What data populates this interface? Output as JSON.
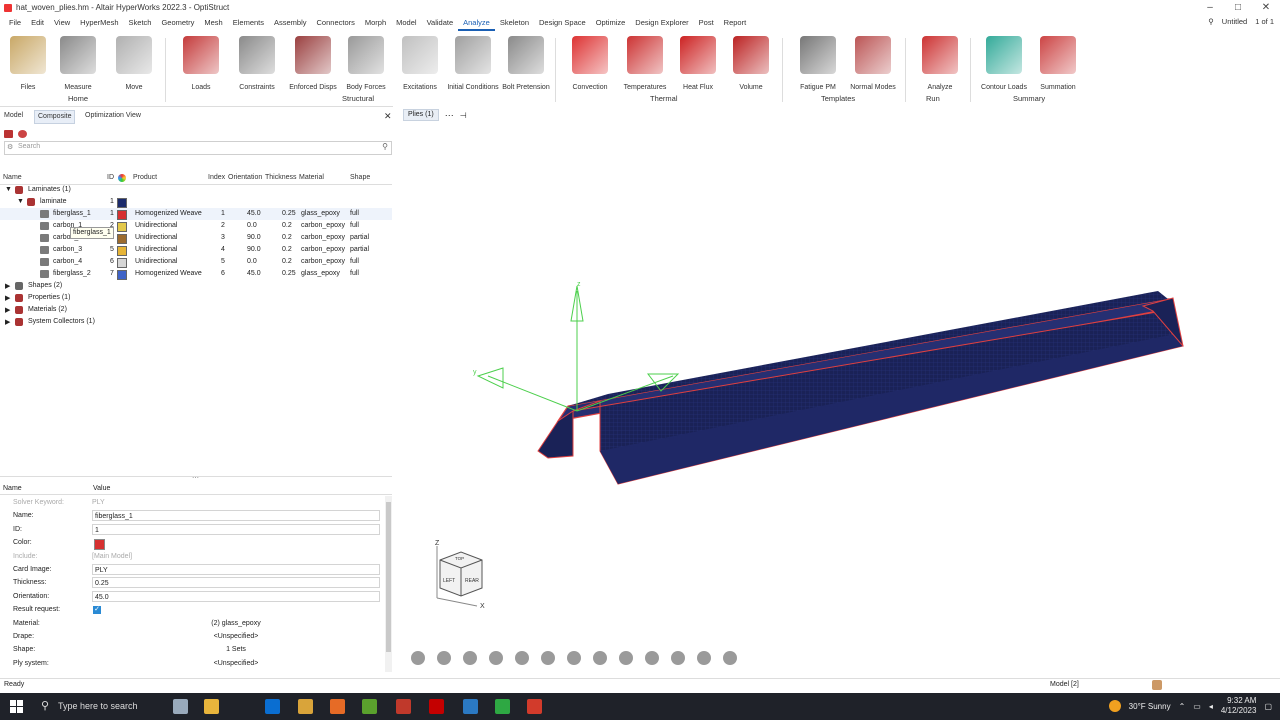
{
  "window": {
    "title": "hat_woven_plies.hm - Altair HyperWorks 2022.3 - OptiStruct",
    "controls": [
      "–",
      "□",
      "✕"
    ]
  },
  "menu": {
    "items": [
      "File",
      "Edit",
      "View",
      "HyperMesh",
      "Sketch",
      "Geometry",
      "Mesh",
      "Elements",
      "Assembly",
      "Connectors",
      "Morph",
      "Model",
      "Validate",
      "Analyze",
      "Skeleton",
      "Design Space",
      "Optimize",
      "Design Explorer",
      "Post",
      "Report"
    ],
    "active": "Analyze",
    "model_name": "Untitled",
    "page": "1 of 1"
  },
  "ribbon": {
    "tools": [
      {
        "label": "Files",
        "icon": "folder-icon",
        "color": "#c9a867"
      },
      {
        "label": "Measure",
        "icon": "measure-icon",
        "color": "#8a8a8a"
      },
      {
        "label": "Move",
        "icon": "move-icon",
        "color": "#b0b0b0"
      },
      {
        "label": "Loads",
        "icon": "loads-icon",
        "color": "#c43b3b"
      },
      {
        "label": "Constraints",
        "icon": "constraints-icon",
        "color": "#8a8a8a"
      },
      {
        "label": "Enforced Disps",
        "icon": "enforced-disps-icon",
        "color": "#9a4040"
      },
      {
        "label": "Body Forces",
        "icon": "body-forces-icon",
        "color": "#999"
      },
      {
        "label": "Excitations",
        "icon": "excitations-icon",
        "color": "#c0c0c0"
      },
      {
        "label": "Initial Conditions",
        "icon": "initial-conditions-icon",
        "color": "#a0a0a0"
      },
      {
        "label": "Bolt Pretension",
        "icon": "bolt-icon",
        "color": "#8a8a8a"
      },
      {
        "label": "Convection",
        "icon": "convection-icon",
        "color": "#d33"
      },
      {
        "label": "Temperatures",
        "icon": "temperatures-icon",
        "color": "#c33"
      },
      {
        "label": "Heat Flux",
        "icon": "heat-flux-icon",
        "color": "#c22"
      },
      {
        "label": "Volume",
        "icon": "volume-icon",
        "color": "#b22"
      },
      {
        "label": "Fatigue PM",
        "icon": "fatigue-icon",
        "color": "#777"
      },
      {
        "label": "Normal Modes",
        "icon": "normal-modes-icon",
        "color": "#b55"
      },
      {
        "label": "Analyze",
        "icon": "analyze-run-icon",
        "color": "#c33"
      },
      {
        "label": "Contour Loads",
        "icon": "contour-loads-icon",
        "color": "#3a9"
      },
      {
        "label": "Summation",
        "icon": "summation-icon",
        "color": "#c44"
      }
    ],
    "groups": [
      "Home",
      "Structural",
      "Thermal",
      "Templates",
      "Run",
      "Summary"
    ]
  },
  "panel": {
    "tabs": [
      "Model",
      "Composite",
      "Optimization View"
    ],
    "active_tab": "Composite",
    "search_placeholder": "Search",
    "columns": [
      "Name",
      "ID",
      "Product",
      "Index",
      "Orientation",
      "Thickness",
      "Material",
      "Shape"
    ],
    "tree": [
      {
        "name": "Laminates (1)",
        "level": 0
      },
      {
        "name": "laminate",
        "level": 1,
        "id": "1",
        "color": "#1b2a6b"
      }
    ],
    "plies": [
      {
        "name": "fiberglass_1",
        "id": "1",
        "color": "#d63030",
        "product": "Homogenized Weave",
        "index": "1",
        "orientation": "45.0",
        "thickness": "0.25",
        "material": "glass_epoxy",
        "shape": "full"
      },
      {
        "name": "carbon_1",
        "id": "2",
        "color": "#e3c84a",
        "product": "Unidirectional",
        "index": "2",
        "orientation": "0.0",
        "thickness": "0.2",
        "material": "carbon_epoxy",
        "shape": "full"
      },
      {
        "name": "carbon_2",
        "id": "3",
        "color": "#9c6b2f",
        "product": "Unidirectional",
        "index": "3",
        "orientation": "90.0",
        "thickness": "0.2",
        "material": "carbon_epoxy",
        "shape": "partial"
      },
      {
        "name": "carbon_3",
        "id": "5",
        "color": "#e6b437",
        "product": "Unidirectional",
        "index": "4",
        "orientation": "90.0",
        "thickness": "0.2",
        "material": "carbon_epoxy",
        "shape": "partial"
      },
      {
        "name": "carbon_4",
        "id": "6",
        "color": "#d6d6d6",
        "product": "Unidirectional",
        "index": "5",
        "orientation": "0.0",
        "thickness": "0.2",
        "material": "carbon_epoxy",
        "shape": "full"
      },
      {
        "name": "fiberglass_2",
        "id": "7",
        "color": "#3f63c7",
        "product": "Homogenized Weave",
        "index": "6",
        "orientation": "45.0",
        "thickness": "0.25",
        "material": "glass_epoxy",
        "shape": "full"
      }
    ],
    "tooltip": "fiberglass_1",
    "collectors": [
      "Shapes (2)",
      "Properties (1)",
      "Materials (2)",
      "System Collectors (1)"
    ]
  },
  "properties": {
    "headers": [
      "Name",
      "Value"
    ],
    "rows": [
      {
        "key": "Solver Keyword:",
        "value": "PLY",
        "disabled": true
      },
      {
        "key": "Name:",
        "value": "fiberglass_1"
      },
      {
        "key": "ID:",
        "value": "1"
      },
      {
        "key": "Color:",
        "value": ""
      },
      {
        "key": "Include:",
        "value": "[Main Model]",
        "disabled": true
      },
      {
        "key": "Card Image:",
        "value": "PLY"
      },
      {
        "key": "Thickness:",
        "value": "0.25"
      },
      {
        "key": "Orientation:",
        "value": "45.0"
      },
      {
        "key": "Result request:",
        "value": ""
      },
      {
        "key": "Material:",
        "value": "(2) glass_epoxy"
      },
      {
        "key": "Drape:",
        "value": "<Unspecified>"
      },
      {
        "key": "Shape:",
        "value": "1 Sets"
      },
      {
        "key": "Ply system:",
        "value": "<Unspecified>"
      }
    ],
    "color_value": "#d63030"
  },
  "viewport": {
    "filter_label": "Plies (1)",
    "axis_x": "x",
    "axis_y": "y",
    "axis_z": "z",
    "cube_z": "Z",
    "cube_x": "X",
    "cube_left": "LEFT",
    "cube_rear": "REAR",
    "cube_top": "TOP",
    "model_color": "#1a2257",
    "edge_color": "#e04040"
  },
  "status": {
    "text": "Ready",
    "model": "Model [2]"
  },
  "taskbar": {
    "search_placeholder": "Type here to search",
    "weather": "30°F  Sunny",
    "time": "9:32 AM",
    "date": "4/12/2023"
  }
}
